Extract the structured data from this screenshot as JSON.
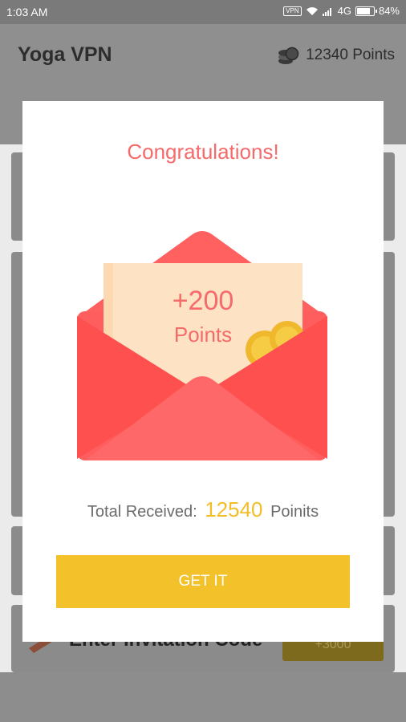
{
  "status_bar": {
    "time": "1:03 AM",
    "vpn": "VPN",
    "network": "4G",
    "battery": "84%",
    "battery_level": 0.84
  },
  "app": {
    "title": "Yoga VPN",
    "points_label": "12340 Points"
  },
  "background": {
    "invite_label": "Enter Invitation Code",
    "invite_button": "+3000"
  },
  "dialog": {
    "title": "Congratulations!",
    "reward_amount": "+200",
    "reward_unit": "Points",
    "total_prefix": "Total Received:",
    "total_value": "12540",
    "total_suffix": "Poinits",
    "button_label": "GET IT"
  },
  "colors": {
    "accent_red": "#f56a6a",
    "envelope_red": "#ff5e5e",
    "gold": "#f3c12a"
  },
  "icons": [
    "coins-icon",
    "wifi-icon",
    "signal-icon",
    "battery-icon",
    "envelope-icon",
    "pencil-icon"
  ]
}
